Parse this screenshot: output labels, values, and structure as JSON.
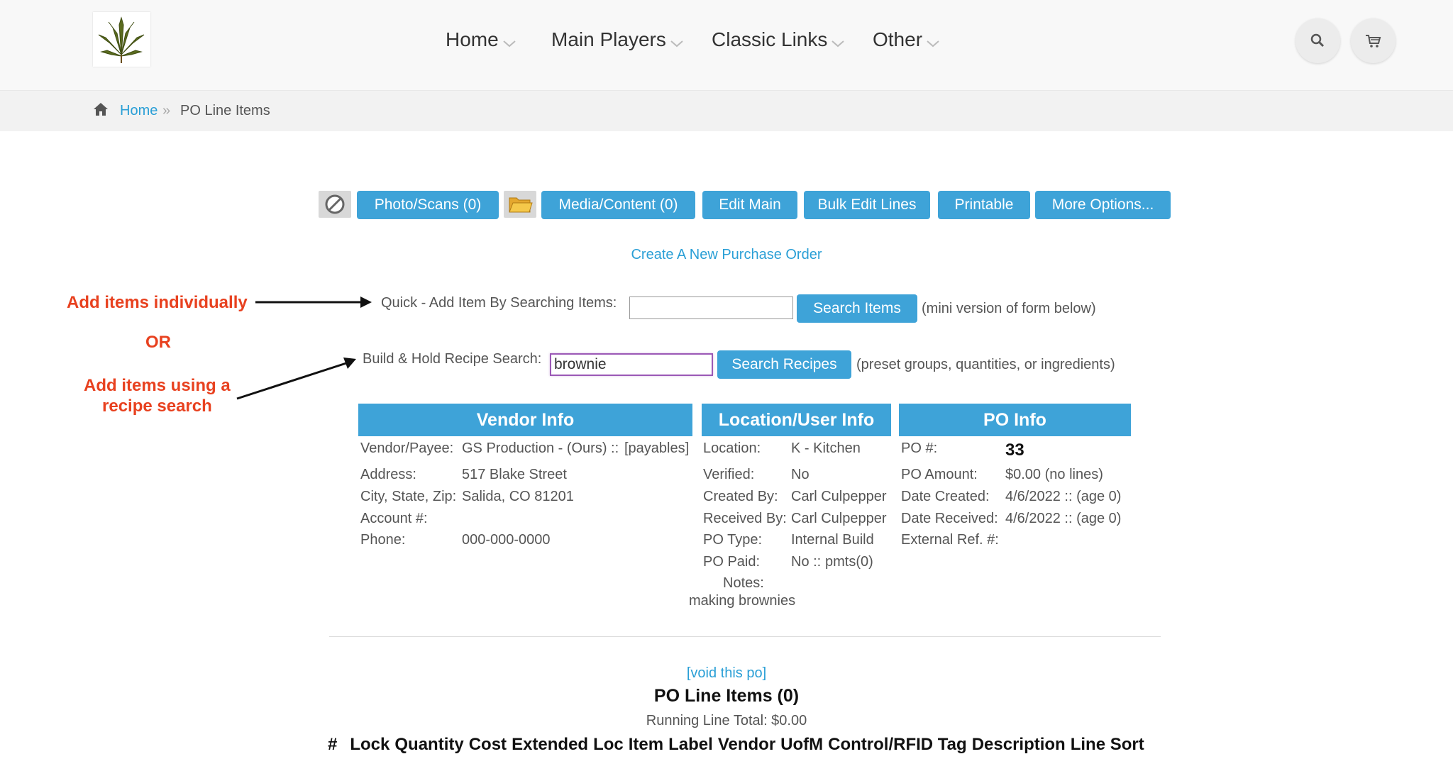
{
  "nav": {
    "items": [
      {
        "label": "Home"
      },
      {
        "label": "Main Players"
      },
      {
        "label": "Classic Links"
      },
      {
        "label": "Other"
      }
    ]
  },
  "breadcrumb": {
    "home": "Home",
    "separator": "»",
    "current": "PO Line Items"
  },
  "toolbar": {
    "photo_scans": "Photo/Scans (0)",
    "media_content": "Media/Content (0)",
    "edit_main": "Edit Main",
    "bulk_edit_lines": "Bulk Edit Lines",
    "printable": "Printable",
    "more_options": "More Options..."
  },
  "create_link": "Create A New Purchase Order",
  "annotations": {
    "add_individually": "Add items individually",
    "or": "OR",
    "recipe_line1": "Add items using a",
    "recipe_line2": "recipe search"
  },
  "quick_add": {
    "label": "Quick - Add Item By Searching Items:",
    "value": "",
    "button": "Search Items",
    "note": "(mini version of form below)"
  },
  "recipe_search": {
    "label": "Build & Hold Recipe Search:",
    "value": "brownie",
    "button": "Search Recipes",
    "note": "(preset groups, quantities, or ingredients)"
  },
  "vendor_info": {
    "title": "Vendor Info",
    "vendor_label": "Vendor/Payee:",
    "vendor_value": "GS Production - (Ours) ::",
    "payables_link": "[payables]",
    "address_label": "Address:",
    "address_value": "517 Blake Street",
    "csz_label": "City, State, Zip:",
    "csz_value": "Salida, CO 81201",
    "account_label": "Account #:",
    "account_value": "",
    "phone_label": "Phone:",
    "phone_value": "000-000-0000"
  },
  "location_info": {
    "title": "Location/User Info",
    "location_label": "Location:",
    "location_value": "K - Kitchen",
    "verified_label": "Verified:",
    "verified_value": "No",
    "created_by_label": "Created By:",
    "created_by_value": "Carl Culpepper",
    "received_by_label": "Received By:",
    "received_by_value": "Carl Culpepper",
    "po_type_label": "PO Type:",
    "po_type_value": "Internal Build",
    "po_paid_label": "PO Paid:",
    "po_paid_value": "No ::",
    "pmts_link": "pmts(0)",
    "notes_label": "Notes:",
    "notes_value": "making brownies"
  },
  "po_info": {
    "title": "PO Info",
    "po_num_label": "PO #:",
    "po_num_value": "33",
    "amount_label": "PO Amount:",
    "amount_value": "$0.00 (no lines)",
    "created_label": "Date Created:",
    "created_value": "4/6/2022 :: (age 0)",
    "received_label": "Date Received:",
    "received_value": "4/6/2022 :: (age 0)",
    "extref_label": "External Ref. #:",
    "extref_value": ""
  },
  "void_link": "[void this po]",
  "line_items": {
    "title": "PO Line Items (0)",
    "running_total": "Running Line Total: $0.00",
    "columns": [
      "#",
      "Lock",
      "Quantity",
      "Cost",
      "Extended",
      "Loc",
      "Item",
      "Label",
      "Vendor",
      "UofM",
      "Control/RFID Tag",
      "Description",
      "Line Sort"
    ]
  },
  "colors": {
    "accent": "#3ea3d8",
    "link": "#2a9fd6",
    "annotation": "#e8411f"
  }
}
